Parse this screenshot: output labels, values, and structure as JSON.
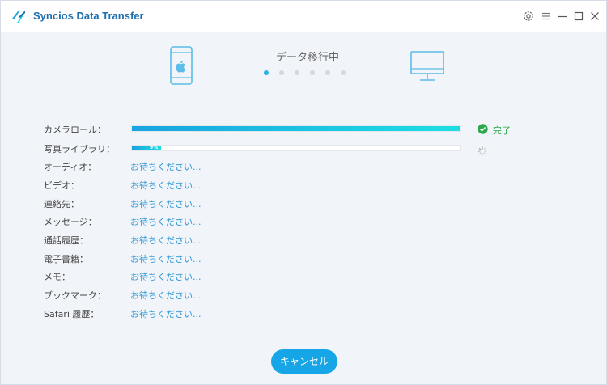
{
  "window": {
    "title": "Syncios Data Transfer"
  },
  "header": {
    "status_title": "データ移行中",
    "step_count": 6,
    "active_step": 1
  },
  "transfer_items": [
    {
      "label": "カメラロール：",
      "state": "done",
      "progress": 1.0,
      "status_label": "完了"
    },
    {
      "label": "写真ライブラリ：",
      "state": "in_progress",
      "progress": 0.09,
      "progress_text": "9%"
    },
    {
      "label": "オーディオ：",
      "state": "waiting",
      "wait_text": "お待ちください..."
    },
    {
      "label": "ビデオ：",
      "state": "waiting",
      "wait_text": "お待ちください..."
    },
    {
      "label": "連絡先：",
      "state": "waiting",
      "wait_text": "お待ちください..."
    },
    {
      "label": "メッセージ：",
      "state": "waiting",
      "wait_text": "お待ちください..."
    },
    {
      "label": "通話履歴：",
      "state": "waiting",
      "wait_text": "お待ちください..."
    },
    {
      "label": "電子書籍：",
      "state": "waiting",
      "wait_text": "お待ちください..."
    },
    {
      "label": "メモ：",
      "state": "waiting",
      "wait_text": "お待ちください..."
    },
    {
      "label": "ブックマーク：",
      "state": "waiting",
      "wait_text": "お待ちください..."
    },
    {
      "label": "Safari 履歴：",
      "state": "waiting",
      "wait_text": "お待ちください..."
    }
  ],
  "footer": {
    "cancel_label": "キャンセル"
  },
  "colors": {
    "accent": "#16a5e6",
    "title": "#1f6fae",
    "done": "#2aa84a",
    "waiting_text": "#2a96d6",
    "progress_start": "#1aa3e0",
    "progress_end": "#1ddfe3"
  },
  "icons": {
    "app": "syncios-logo-icon",
    "source_device": "iphone-apple-icon",
    "target_device": "monitor-icon",
    "settings": "gear-icon",
    "menu": "menu-icon",
    "minimize": "minimize-icon",
    "maximize": "maximize-icon",
    "close": "close-icon",
    "done": "check-circle-icon",
    "loading": "spinner-icon"
  }
}
